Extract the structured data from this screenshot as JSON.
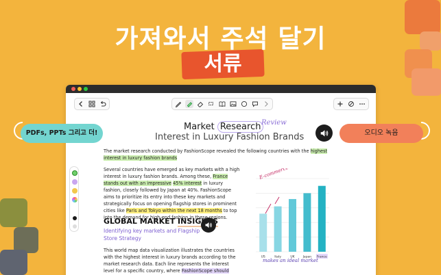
{
  "hero": {
    "title": "가져와서 주석 달기",
    "subtitle": "서류"
  },
  "callouts": {
    "left": "PDFs, PPTs 그리고 더!",
    "right": "오디오 녹음"
  },
  "toolbar": {
    "icons": [
      "chevron-left-icon",
      "grid-icon",
      "undo-icon",
      "pen-icon",
      "highlighter-icon",
      "eraser-icon",
      "lasso-icon",
      "book-icon",
      "image-icon",
      "shape-icon",
      "comment-icon",
      "chevron-right-icon",
      "plus-icon",
      "edit-off-icon",
      "more-icon"
    ]
  },
  "document": {
    "title_prefix": "Market ",
    "title_boxed": "Research",
    "review_note": "Review",
    "subtitle": "Interest in Luxury Fashion Brands",
    "para1": {
      "a": "The market research conducted by FashionScope revealed the following countries with the ",
      "b": "highest interest in luxury fashion brands"
    },
    "para2": {
      "a": "Several countries have emerged as key markets with a high interest in luxury fashion brands. Among these, ",
      "b": "France stands out with an impressive",
      "c": " ",
      "d": "45% interest",
      "e": " in luxury fashion, closely followed by Japan at 40%. FashionScope aims to prioritize its entry into these key markets and strategically focus on opening flagship stores in prominent cities like ",
      "f": "Paris and Tokyo within the next 18 months",
      "g": " to top into the demand for high-end fashion in these regions."
    },
    "section_title_a": "GLOBAL MARKET ",
    "section_title_b": "INSIGHTS",
    "section_subtitle": "Identifying key markets and Flagship Store Strategy",
    "para3": {
      "a": "This world map data visualization illustrates the countries with the highest interest in luxury brands according to the market research data. Each line represents the interest level for a specific country, where ",
      "b": "FashionScope should prioritize entry."
    }
  },
  "chart_data": {
    "type": "bar",
    "categories": [
      "US",
      "Italy",
      "UK",
      "Japan",
      "France"
    ],
    "values": [
      26,
      31,
      36,
      40,
      45
    ],
    "ylim": [
      0,
      50
    ],
    "grid": true,
    "annotations": [
      "E-commerce luxury",
      "makes an ideal market"
    ],
    "colors": [
      "#a8e0ea",
      "#87d6e3",
      "#62c9d9",
      "#43bccd",
      "#24b2c3"
    ]
  },
  "palette": {
    "colors": [
      "#6fcf6b",
      "#c9a6f0",
      "#f2c74c",
      "#f1e2a8",
      "#1b1b1b",
      "#dddddd"
    ]
  },
  "accent_colors": {
    "background": "#f3b43d",
    "hero_pill": "#e8552d",
    "callout_left": "#73d5d0",
    "callout_right": "#f2805a"
  }
}
